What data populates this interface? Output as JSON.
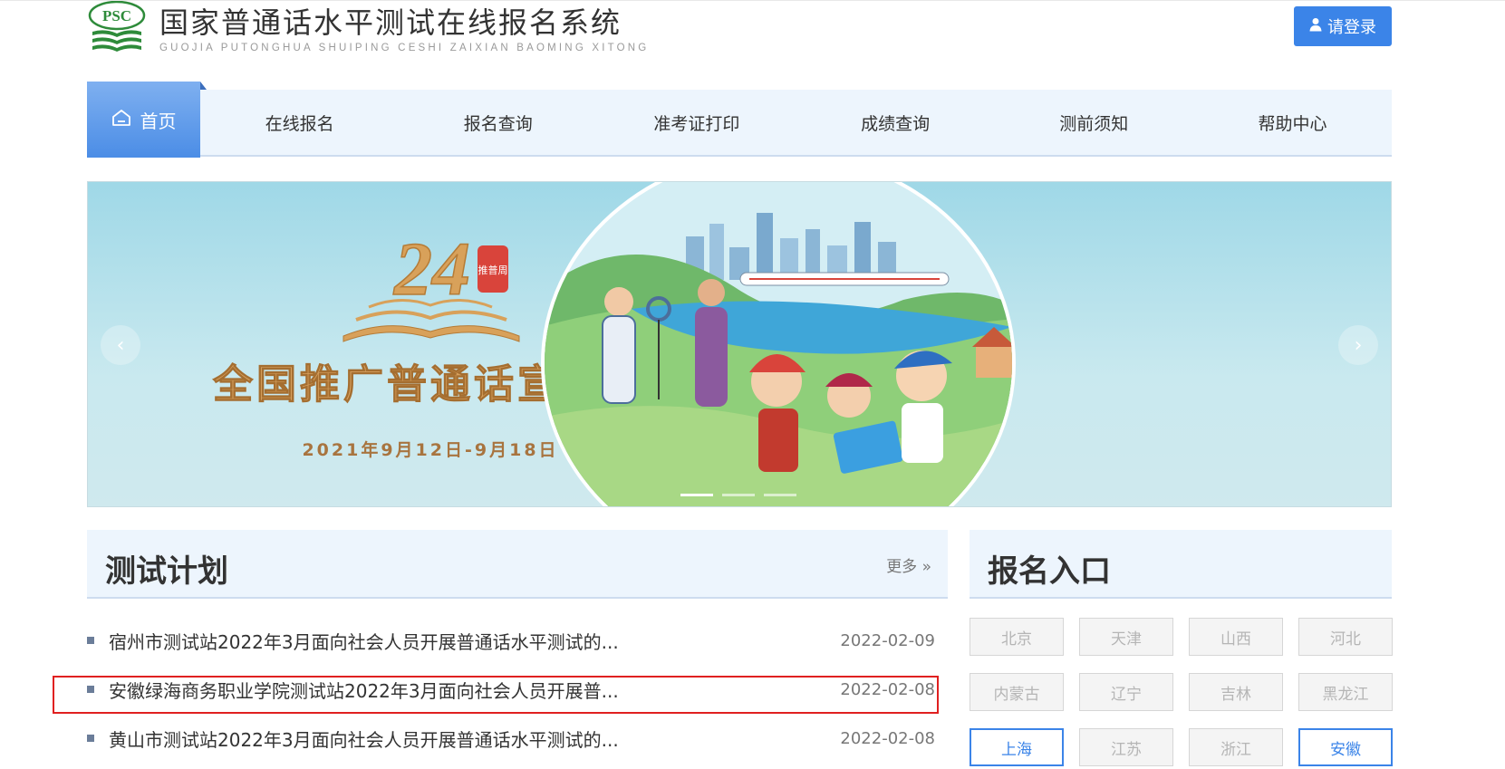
{
  "header": {
    "logo_text": "PSC",
    "title_cn": "国家普通话水平测试在线报名系统",
    "title_en": "GUOJIA PUTONGHUA SHUIPING CESHI ZAIXIAN BAOMING XITONG",
    "login_label": "请登录"
  },
  "nav": {
    "home_label": "首页",
    "items": [
      "在线报名",
      "报名查询",
      "准考证打印",
      "成绩查询",
      "测前须知",
      "帮助中心"
    ]
  },
  "banner": {
    "big_number": "24",
    "seal_text": "推普周",
    "headline": "全国推广普通话宣传周",
    "dates": "2021年9月12日-9月18日",
    "prev_arrow": "‹",
    "next_arrow": "›",
    "slides": 3,
    "active_slide": 1
  },
  "plan": {
    "title": "测试计划",
    "more_label": "更多 »",
    "items": [
      {
        "text": "宿州市测试站2022年3月面向社会人员开展普通话水平测试的...",
        "date": "2022-02-09"
      },
      {
        "text": "安徽绿海商务职业学院测试站2022年3月面向社会人员开展普...",
        "date": "2022-02-08"
      },
      {
        "text": "黄山市测试站2022年3月面向社会人员开展普通话水平测试的...",
        "date": "2022-02-08"
      }
    ]
  },
  "registration": {
    "title": "报名入口",
    "provinces": [
      {
        "name": "北京",
        "active": false
      },
      {
        "name": "天津",
        "active": false
      },
      {
        "name": "山西",
        "active": false
      },
      {
        "name": "河北",
        "active": false
      },
      {
        "name": "内蒙古",
        "active": false
      },
      {
        "name": "辽宁",
        "active": false
      },
      {
        "name": "吉林",
        "active": false
      },
      {
        "name": "黑龙江",
        "active": false
      },
      {
        "name": "上海",
        "active": true
      },
      {
        "name": "江苏",
        "active": false
      },
      {
        "name": "浙江",
        "active": false
      },
      {
        "name": "安徽",
        "active": true
      }
    ]
  },
  "colors": {
    "accent": "#3b84e8",
    "nav_bg": "#edf5fd",
    "highlight_border": "#e02020",
    "logo_green": "#2e8b3a"
  }
}
